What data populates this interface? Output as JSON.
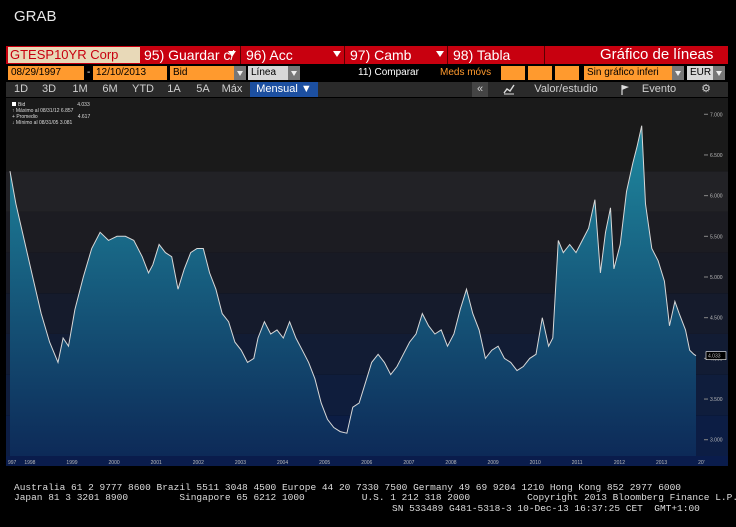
{
  "window": {
    "title": "GRAB"
  },
  "command_bar": {
    "ticker": "GTESP10YR Corp",
    "save": "95) Guardar c/",
    "actions": "96) Acc",
    "change": "97) Camb",
    "table": "98) Tabla",
    "view_title": "Gráfico de líneas"
  },
  "controls": {
    "start_date": "08/29/1997",
    "dash": "-",
    "end_date": "12/10/2013",
    "field": "Bid",
    "chart_type": "Línea",
    "compare": "11) Comparar",
    "moving_avg": "Meds móvs",
    "chart_mode": "Sin gráfico inferi",
    "currency": "EUR"
  },
  "periods": {
    "items": [
      "1D",
      "3D",
      "1M",
      "6M",
      "YTD",
      "1A",
      "5A",
      "Máx"
    ],
    "frequency": "Mensual",
    "frequency_arrow": "▼",
    "nav": "«",
    "value_study": "Valor/estudio",
    "event": "Evento",
    "settings_icon": "⚙"
  },
  "legend": {
    "series": "Bid",
    "series_value": "4.033",
    "max": "Máximo al 08/31/12",
    "max_value": "6.857",
    "avg": "Promedio",
    "avg_value": "4.617",
    "min": "Mínimo al 08/31/05",
    "min_value": "3.081"
  },
  "chart_data": {
    "type": "area",
    "series": [
      {
        "name": "Bid",
        "last": 4.033
      }
    ],
    "y_ticks": [
      "7.000",
      "6.500",
      "6.000",
      "5.500",
      "5.000",
      "4.500",
      "4.000",
      "3.500",
      "3.000"
    ],
    "ylim": [
      2.8,
      7.2
    ],
    "x_ticks": [
      "997",
      "1998",
      "1999",
      "2000",
      "2001",
      "2002",
      "2003",
      "2004",
      "2005",
      "2006",
      "2007",
      "2008",
      "2009",
      "2010",
      "2011",
      "2012",
      "2013",
      "20'"
    ],
    "x_range": [
      1997.66,
      2013.95
    ],
    "points": [
      [
        1997.66,
        6.3
      ],
      [
        1997.8,
        5.9
      ],
      [
        1998.0,
        5.45
      ],
      [
        1998.2,
        5.0
      ],
      [
        1998.4,
        4.55
      ],
      [
        1998.6,
        4.2
      ],
      [
        1998.8,
        3.95
      ],
      [
        1998.92,
        4.25
      ],
      [
        1999.05,
        4.15
      ],
      [
        1999.2,
        4.6
      ],
      [
        1999.4,
        5.0
      ],
      [
        1999.6,
        5.35
      ],
      [
        1999.8,
        5.55
      ],
      [
        2000.0,
        5.45
      ],
      [
        2000.2,
        5.5
      ],
      [
        2000.4,
        5.5
      ],
      [
        2000.6,
        5.45
      ],
      [
        2000.8,
        5.25
      ],
      [
        2000.95,
        5.05
      ],
      [
        2001.05,
        5.15
      ],
      [
        2001.2,
        5.4
      ],
      [
        2001.35,
        5.3
      ],
      [
        2001.5,
        5.25
      ],
      [
        2001.65,
        4.85
      ],
      [
        2001.8,
        5.1
      ],
      [
        2001.95,
        5.3
      ],
      [
        2002.1,
        5.35
      ],
      [
        2002.25,
        5.35
      ],
      [
        2002.4,
        5.05
      ],
      [
        2002.55,
        4.85
      ],
      [
        2002.7,
        4.55
      ],
      [
        2002.85,
        4.45
      ],
      [
        2003.0,
        4.2
      ],
      [
        2003.15,
        4.1
      ],
      [
        2003.3,
        3.95
      ],
      [
        2003.45,
        4.0
      ],
      [
        2003.55,
        4.25
      ],
      [
        2003.7,
        4.45
      ],
      [
        2003.85,
        4.3
      ],
      [
        2004.0,
        4.35
      ],
      [
        2004.15,
        4.25
      ],
      [
        2004.3,
        4.45
      ],
      [
        2004.45,
        4.25
      ],
      [
        2004.6,
        4.1
      ],
      [
        2004.75,
        3.95
      ],
      [
        2004.9,
        3.75
      ],
      [
        2005.05,
        3.45
      ],
      [
        2005.2,
        3.25
      ],
      [
        2005.35,
        3.15
      ],
      [
        2005.5,
        3.1
      ],
      [
        2005.66,
        3.08
      ],
      [
        2005.8,
        3.4
      ],
      [
        2005.95,
        3.45
      ],
      [
        2006.1,
        3.7
      ],
      [
        2006.25,
        3.95
      ],
      [
        2006.4,
        4.05
      ],
      [
        2006.55,
        3.95
      ],
      [
        2006.7,
        3.8
      ],
      [
        2006.85,
        3.9
      ],
      [
        2007.0,
        4.05
      ],
      [
        2007.15,
        4.2
      ],
      [
        2007.3,
        4.3
      ],
      [
        2007.45,
        4.55
      ],
      [
        2007.6,
        4.4
      ],
      [
        2007.75,
        4.3
      ],
      [
        2007.9,
        4.35
      ],
      [
        2008.05,
        4.15
      ],
      [
        2008.2,
        4.3
      ],
      [
        2008.35,
        4.6
      ],
      [
        2008.5,
        4.85
      ],
      [
        2008.65,
        4.55
      ],
      [
        2008.8,
        4.35
      ],
      [
        2008.95,
        4.0
      ],
      [
        2009.1,
        4.1
      ],
      [
        2009.25,
        4.15
      ],
      [
        2009.4,
        4.0
      ],
      [
        2009.55,
        3.95
      ],
      [
        2009.7,
        3.85
      ],
      [
        2009.85,
        3.9
      ],
      [
        2010.0,
        4.0
      ],
      [
        2010.15,
        4.05
      ],
      [
        2010.3,
        4.5
      ],
      [
        2010.45,
        4.15
      ],
      [
        2010.55,
        4.25
      ],
      [
        2010.68,
        5.45
      ],
      [
        2010.8,
        5.3
      ],
      [
        2010.95,
        5.4
      ],
      [
        2011.1,
        5.3
      ],
      [
        2011.25,
        5.45
      ],
      [
        2011.4,
        5.6
      ],
      [
        2011.55,
        5.95
      ],
      [
        2011.68,
        5.05
      ],
      [
        2011.8,
        5.55
      ],
      [
        2011.92,
        5.85
      ],
      [
        2012.0,
        5.1
      ],
      [
        2012.15,
        5.4
      ],
      [
        2012.3,
        6.05
      ],
      [
        2012.45,
        6.4
      ],
      [
        2012.55,
        6.6
      ],
      [
        2012.66,
        6.86
      ],
      [
        2012.75,
        5.9
      ],
      [
        2012.9,
        5.35
      ],
      [
        2013.05,
        5.2
      ],
      [
        2013.2,
        4.95
      ],
      [
        2013.32,
        4.4
      ],
      [
        2013.45,
        4.7
      ],
      [
        2013.55,
        4.55
      ],
      [
        2013.7,
        4.35
      ],
      [
        2013.8,
        4.1
      ],
      [
        2013.9,
        4.05
      ],
      [
        2013.95,
        4.033
      ]
    ]
  },
  "footer": {
    "line1": "Australia 61 2 9777 8600 Brazil 5511 3048 4500 Europe 44 20 7330 7500 Germany 49 69 9204 1210 Hong Kong 852 2977 6000",
    "line2": "Japan 81 3 3201 8900         Singapore 65 6212 1000          U.S. 1 212 318 2000          Copyright 2013 Bloomberg Finance L.P.",
    "line3": "SN 533489 G481-5318-3 10-Dec-13 16:37:25 CET  GMT+1:00"
  },
  "colors": {
    "accent_red": "#c8000f",
    "input_orange": "#ff9a2e",
    "tab_blue": "#1c4fa0",
    "area_top": "#1f8aa0",
    "area_bottom": "#0d2a58"
  }
}
